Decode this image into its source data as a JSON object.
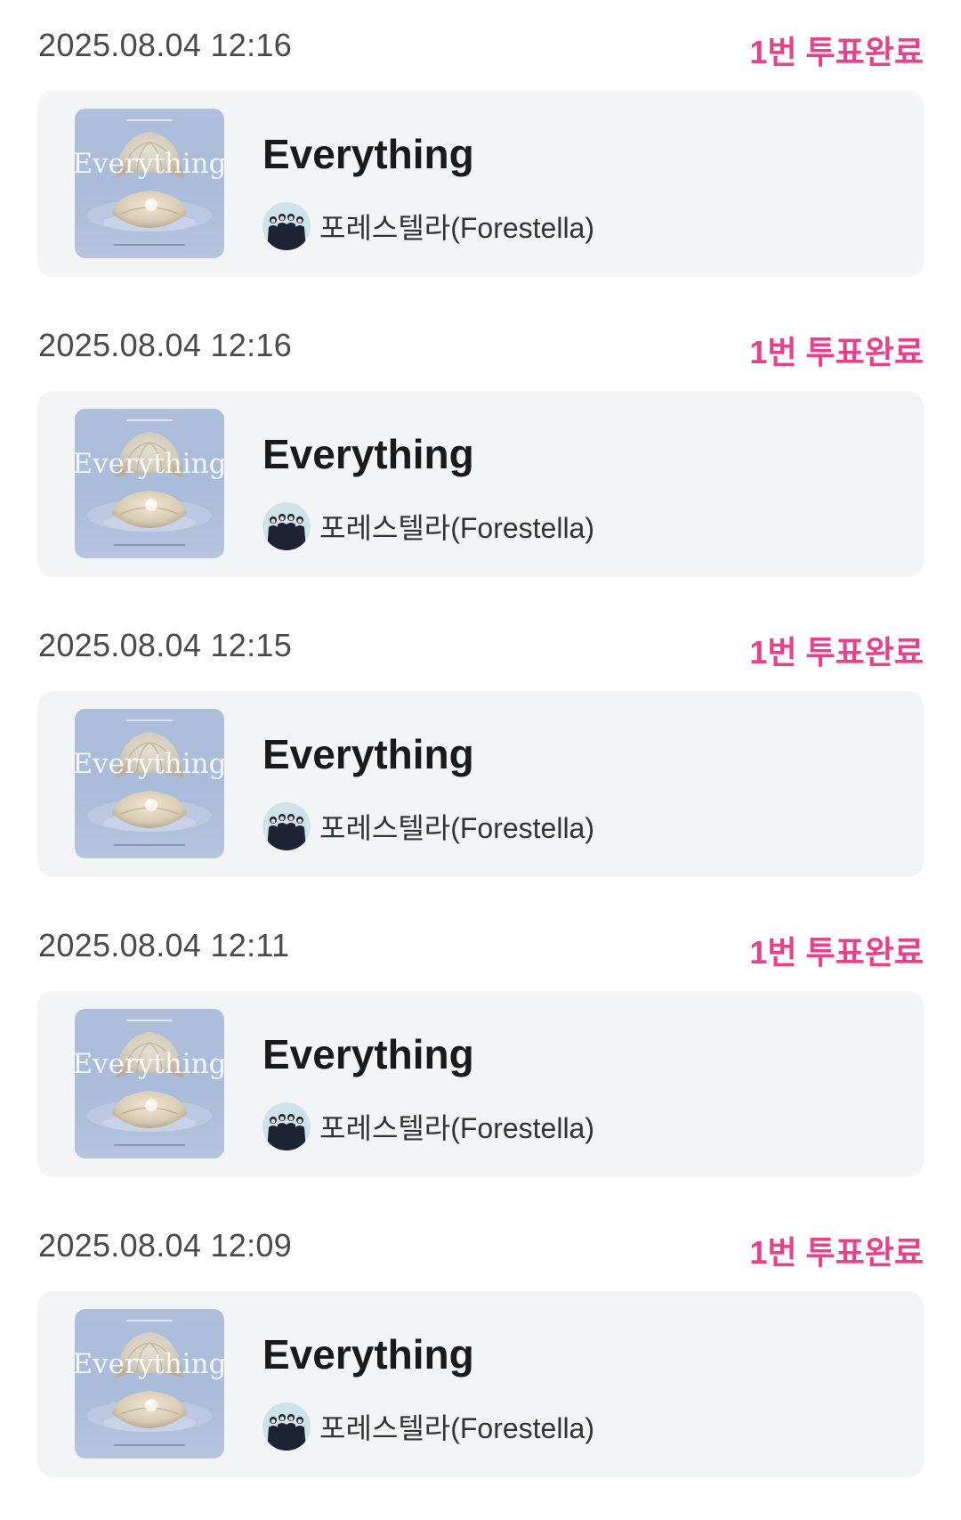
{
  "colors": {
    "accent_pink": "#e8408a",
    "card_background": "#f3f4f6",
    "timestamp_text": "#4a4a4a"
  },
  "icons": {
    "album_art": "album-cover-image",
    "artist_avatar": "artist-avatar-image"
  },
  "votes": [
    {
      "timestamp": "2025.08.04 12:16",
      "status": "1번 투표완료",
      "song_title": "Everything",
      "artist": "포레스텔라(Forestella)"
    },
    {
      "timestamp": "2025.08.04 12:16",
      "status": "1번 투표완료",
      "song_title": "Everything",
      "artist": "포레스텔라(Forestella)"
    },
    {
      "timestamp": "2025.08.04 12:15",
      "status": "1번 투표완료",
      "song_title": "Everything",
      "artist": "포레스텔라(Forestella)"
    },
    {
      "timestamp": "2025.08.04 12:11",
      "status": "1번 투표완료",
      "song_title": "Everything",
      "artist": "포레스텔라(Forestella)"
    },
    {
      "timestamp": "2025.08.04 12:09",
      "status": "1번 투표완료",
      "song_title": "Everything",
      "artist": "포레스텔라(Forestella)"
    }
  ]
}
